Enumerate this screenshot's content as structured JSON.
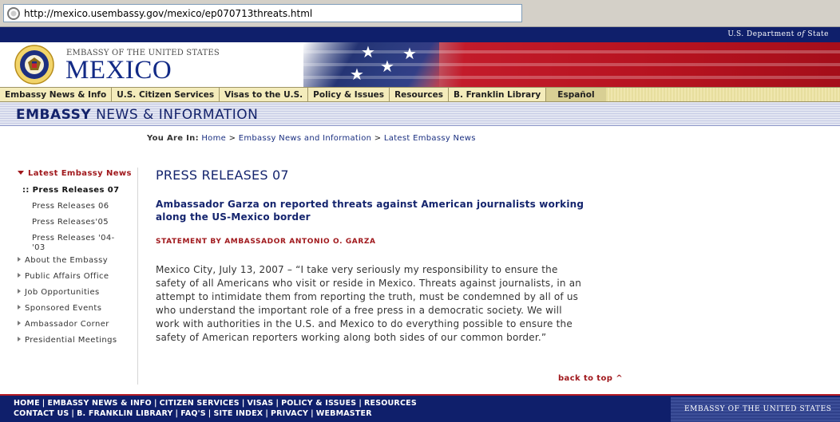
{
  "browser": {
    "url": "http://mexico.usembassy.gov/mexico/ep070713threats.html"
  },
  "header": {
    "state_dept_prefix": "U.S. Department ",
    "state_dept_of": "of",
    "state_dept_suffix": " State",
    "embassy_of": "EMBASSY OF THE UNITED STATES",
    "country": "MEXICO"
  },
  "nav": {
    "items": [
      {
        "label": "Embassy News & Info"
      },
      {
        "label": "U.S. Citizen Services"
      },
      {
        "label": "Visas to the U.S."
      },
      {
        "label": "Policy & Issues"
      },
      {
        "label": "Resources"
      },
      {
        "label": "B. Franklin Library"
      },
      {
        "label": "Español"
      }
    ]
  },
  "section": {
    "bold": "EMBASSY",
    "rest": " NEWS & INFORMATION"
  },
  "breadcrumb": {
    "label": "You Are In:",
    "items": [
      "Home",
      "Embassy News and Information",
      "Latest Embassy News"
    ],
    "sep": " > "
  },
  "sidebar": {
    "top": "Latest Embassy News",
    "current": ":: Press Releases 07",
    "subs": [
      "Press Releases 06",
      "Press Releases'05",
      "Press Releases '04-",
      "'03"
    ],
    "main": [
      "About the Embassy",
      "Public Affairs Office",
      "Job Opportunities",
      "Sponsored Events",
      "Ambassador Corner",
      "Presidential Meetings"
    ]
  },
  "content": {
    "page_title": "PRESS RELEASES 07",
    "headline_line1": "Ambassador Garza on reported threats against American journalists working",
    "headline_line2": "along the US-Mexico border",
    "statement": "STATEMENT BY AMBASSADOR ANTONIO O. GARZA",
    "body": [
      "Mexico City, July 13, 2007 – “I take very seriously my responsibility to ensure the",
      "safety of all Americans who visit or reside in Mexico. Threats against journalists, in an",
      "attempt to intimidate them from reporting the truth, must be condemned by all of us",
      "who understand the important role of a free press in a democratic society. We will",
      "work with authorities in the U.S. and Mexico to do everything possible to ensure the",
      "safety of American reporters working along both sides of our common border.”"
    ],
    "back_to_top": "back to top ^"
  },
  "footer": {
    "row1": [
      "HOME",
      "EMBASSY NEWS & INFO",
      "CITIZEN SERVICES",
      "VISAS",
      "POLICY & ISSUES",
      "RESOURCES"
    ],
    "row2": [
      "CONTACT US",
      "B. FRANKLIN LIBRARY",
      "FAQ'S",
      "SITE INDEX",
      "PRIVACY",
      "WEBMASTER"
    ],
    "sep": "|",
    "brand": "EMBASSY OF THE UNITED STATES"
  },
  "colors": {
    "navy": "#0f1f6b",
    "title_blue": "#15256e",
    "accent_red": "#a0181c",
    "nav_tan": "#efe6ae"
  }
}
